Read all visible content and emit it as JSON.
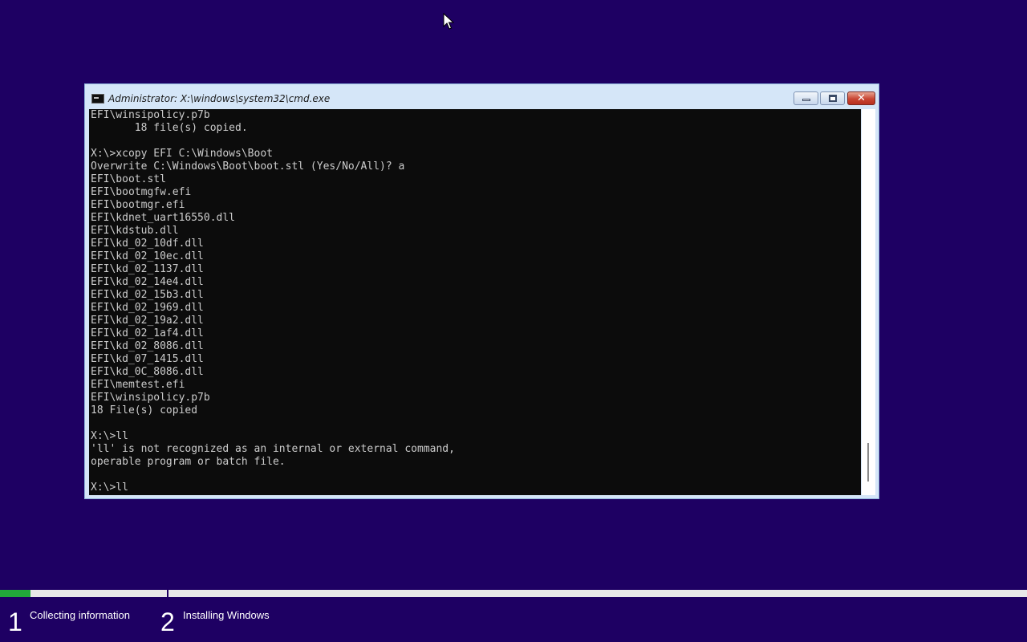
{
  "colors": {
    "desktop_background": "#1e0063",
    "console_background": "#0c0c0c",
    "console_text": "#cccccc",
    "progress_fill": "#22a83a",
    "progress_track": "#e8e8e8"
  },
  "icons": {
    "window_icon": "cmd-icon",
    "mouse": "mouse-pointer-icon",
    "minimize": "minimize-icon",
    "maximize": "maximize-icon",
    "close": "close-icon"
  },
  "window": {
    "title": "Administrator: X:\\windows\\system32\\cmd.exe",
    "close_glyph": "✕"
  },
  "console": {
    "lines": [
      "EFI\\winsipolicy.p7b",
      "       18 file(s) copied.",
      "",
      "X:\\>xcopy EFI C:\\Windows\\Boot",
      "Overwrite C:\\Windows\\Boot\\boot.stl (Yes/No/All)? a",
      "EFI\\boot.stl",
      "EFI\\bootmgfw.efi",
      "EFI\\bootmgr.efi",
      "EFI\\kdnet_uart16550.dll",
      "EFI\\kdstub.dll",
      "EFI\\kd_02_10df.dll",
      "EFI\\kd_02_10ec.dll",
      "EFI\\kd_02_1137.dll",
      "EFI\\kd_02_14e4.dll",
      "EFI\\kd_02_15b3.dll",
      "EFI\\kd_02_1969.dll",
      "EFI\\kd_02_19a2.dll",
      "EFI\\kd_02_1af4.dll",
      "EFI\\kd_02_8086.dll",
      "EFI\\kd_07_1415.dll",
      "EFI\\kd_0C_8086.dll",
      "EFI\\memtest.efi",
      "EFI\\winsipolicy.p7b",
      "18 File(s) copied",
      "",
      "X:\\>ll",
      "'ll' is not recognized as an internal or external command,",
      "operable program or batch file.",
      "",
      "X:\\>ll"
    ]
  },
  "setup_progress": {
    "fraction": 0.03,
    "steps": [
      {
        "number": "1",
        "label": "Collecting information"
      },
      {
        "number": "2",
        "label": "Installing Windows"
      }
    ]
  }
}
